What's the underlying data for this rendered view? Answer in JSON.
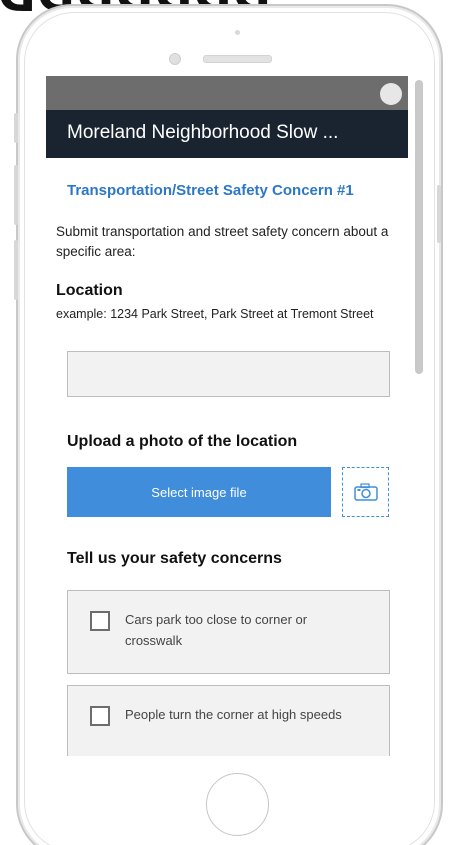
{
  "app": {
    "title": "Moreland Neighborhood Slow ..."
  },
  "form": {
    "section_title": "Transportation/Street Safety Concern #1",
    "intro": "Submit transportation and street safety concern about a specific area:",
    "location": {
      "label": "Location",
      "hint": "example: 1234 Park Street, Park Street at Tremont Street",
      "value": ""
    },
    "photo": {
      "label": "Upload a photo of the location",
      "select_button": "Select image file",
      "camera_icon": "camera-icon"
    },
    "concerns": {
      "label": "Tell us your safety concerns",
      "options": [
        {
          "label": "Cars park too close to corner or crosswalk",
          "checked": false
        },
        {
          "label": "People turn the corner at high speeds",
          "checked": false
        }
      ]
    }
  },
  "colors": {
    "header_bg": "#1a2330",
    "accent": "#3f8ddb",
    "section_title": "#2d78c6",
    "status_bar": "#6d6d6d"
  }
}
